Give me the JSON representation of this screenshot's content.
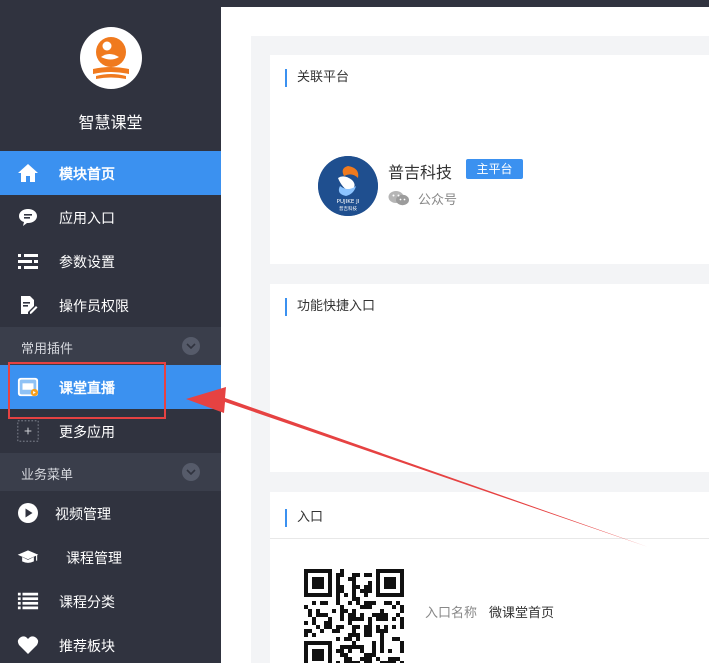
{
  "app": {
    "name": "智慧课堂"
  },
  "sidebar": {
    "items": [
      {
        "label": "模块首页",
        "icon": "home-icon",
        "active": true
      },
      {
        "label": "应用入口",
        "icon": "chat-bubble-icon"
      },
      {
        "label": "参数设置",
        "icon": "list-settings-icon"
      },
      {
        "label": "操作员权限",
        "icon": "document-edit-icon"
      }
    ],
    "groups": [
      {
        "label": "常用插件",
        "items": [
          {
            "label": "课堂直播",
            "icon": "live-classroom-icon",
            "active": true
          },
          {
            "label": "更多应用",
            "icon": "plus-icon"
          }
        ]
      },
      {
        "label": "业务菜单",
        "items": [
          {
            "label": "视频管理",
            "icon": "play-icon"
          },
          {
            "label": "课程管理",
            "icon": "graduation-cap-icon"
          },
          {
            "label": "课程分类",
            "icon": "list-icon"
          },
          {
            "label": "推荐板块",
            "icon": "heart-icon"
          }
        ]
      }
    ]
  },
  "main": {
    "linked_platform": {
      "title": "关联平台",
      "company": "普吉科技",
      "badge": "主平台",
      "account_type": "公众号",
      "logo_text_top": "PUJIKE JI",
      "logo_text_bottom": "普吉科技"
    },
    "shortcuts": {
      "title": "功能快捷入口"
    },
    "entry": {
      "title": "入口",
      "name_label": "入口名称",
      "name_value": "微课堂首页"
    }
  },
  "colors": {
    "sidebar_bg": "#30333f",
    "accent": "#3b91f0",
    "annotation": "#e64242",
    "logo_orange": "#f07a1e"
  }
}
